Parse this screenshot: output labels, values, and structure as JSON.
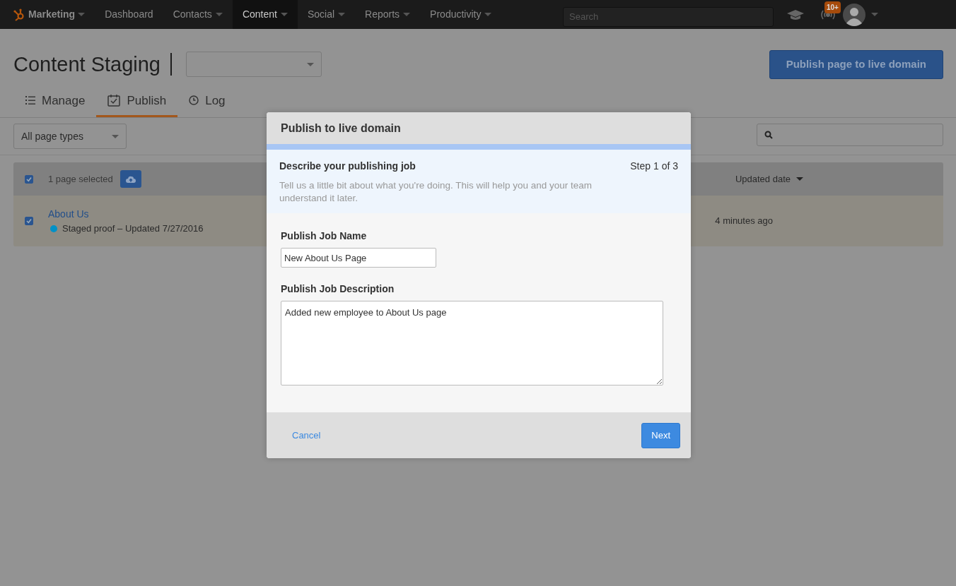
{
  "nav": {
    "brand": "Marketing",
    "items": [
      {
        "label": "Dashboard",
        "dropdown": false,
        "selected": false
      },
      {
        "label": "Contacts",
        "dropdown": true,
        "selected": false
      },
      {
        "label": "Content",
        "dropdown": true,
        "selected": true
      },
      {
        "label": "Social",
        "dropdown": true,
        "selected": false
      },
      {
        "label": "Reports",
        "dropdown": true,
        "selected": false
      },
      {
        "label": "Productivity",
        "dropdown": true,
        "selected": false
      }
    ],
    "search": {
      "placeholder": "Search"
    },
    "notification_badge": "10+"
  },
  "page": {
    "title": "Content Staging",
    "primary_button": "Publish page to live domain",
    "tabs": [
      {
        "label": "Manage",
        "kind": "list",
        "selected": false
      },
      {
        "label": "Publish",
        "kind": "calendar",
        "selected": true
      },
      {
        "label": "Log",
        "kind": "clock",
        "selected": false
      }
    ],
    "filter": "All page types",
    "table": {
      "header": {
        "checked": true,
        "selection_text": "1 page selected",
        "sort_column": "Updated date"
      },
      "rows": [
        {
          "checked": true,
          "title": "About Us",
          "status": "Staged proof – Updated 7/27/2016",
          "color": "#0091c7",
          "updated": "4 minutes ago"
        }
      ]
    }
  },
  "modal": {
    "title": "Publish to live domain",
    "step_heading": "Describe your publishing job",
    "step_counter": "Step 1 of 3",
    "step_hint": "Tell us a little bit about what you're doing. This will help you and your team understand it later.",
    "fields": [
      {
        "kind": "text",
        "label": "Publish Job Name",
        "value": "New About Us Page"
      },
      {
        "kind": "textarea",
        "label": "Publish Job Description",
        "value": "Added new employee to About Us page"
      }
    ],
    "cancel": "Cancel",
    "next": "Next"
  }
}
